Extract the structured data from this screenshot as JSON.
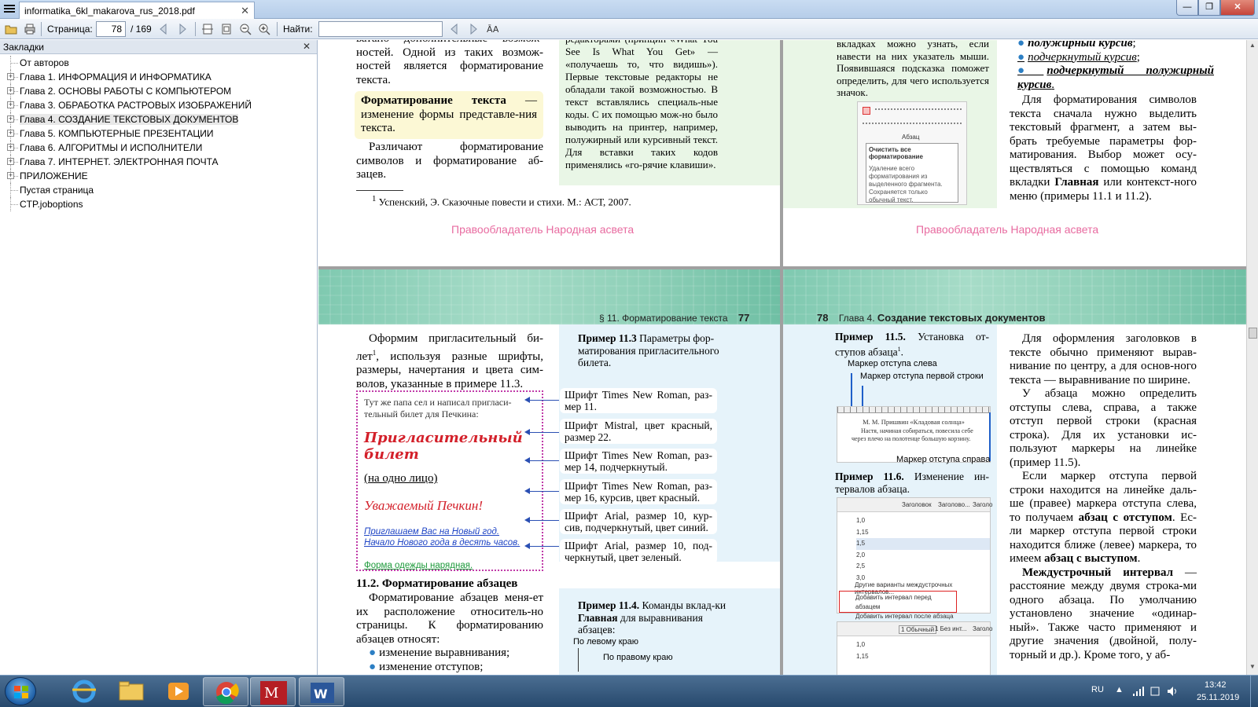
{
  "window": {
    "tab_title": "informatika_6kl_makarova_rus_2018.pdf",
    "tab_close": "✕",
    "min": "—",
    "max": "❐",
    "close": "✕"
  },
  "toolbar": {
    "page_label": "Страница:",
    "page_current": "78",
    "page_total": "/ 169",
    "find_label": "Найти:",
    "find_value": ""
  },
  "bookmarks": {
    "title": "Закладки",
    "close": "✕",
    "items": [
      {
        "label": "От авторов",
        "expandable": false
      },
      {
        "label": "Глава 1. ИНФОРМАЦИЯ И ИНФОРМАТИКА",
        "expandable": true
      },
      {
        "label": "Глава 2. ОСНОВЫ РАБОТЫ С КОМПЬЮТЕРОМ",
        "expandable": true
      },
      {
        "label": "Глава 3. ОБРАБОТКА РАСТРОВЫХ ИЗОБРАЖЕНИЙ",
        "expandable": true
      },
      {
        "label": "Глава 4. СОЗДАНИЕ ТЕКСТОВЫХ ДОКУМЕНТОВ",
        "expandable": true,
        "selected": true
      },
      {
        "label": "Глава 5. КОМПЬЮТЕРНЫЕ ПРЕЗЕНТАЦИИ",
        "expandable": true
      },
      {
        "label": "Глава 6. АЛГОРИТМЫ И ИСПОЛНИТЕЛИ",
        "expandable": true
      },
      {
        "label": "Глава 7. ИНТЕРНЕТ. ЭЛЕКТРОННАЯ ПОЧТА",
        "expandable": true
      },
      {
        "label": "ПРИЛОЖЕНИЕ",
        "expandable": true
      },
      {
        "label": "Пустая страница",
        "expandable": false
      },
      {
        "label": "CTP.joboptions",
        "expandable": false
      }
    ]
  },
  "page76": {
    "lead": "ватано дополнительные возмож-ностей. Одной из таких возмож-ностей является форматирование текста.",
    "def_term": "Форматирование текста",
    "def_rest": " — изменение формы представле-ния текста.",
    "distinguish": "Различают форматирование символов и форматирование аб-зацев.",
    "footnote": "Успенский, Э. Сказочные повести и стихи. М.: АСТ, 2007.",
    "footnote_mark": "1",
    "side_text": "редакторами (принцип «What You See Is What You Get» — «получаешь то, что видишь»). Первые текстовые редакторы не обладали такой возможностью. В текст вставлялись специаль-ные коды. С их помощью мож-но было выводить на принтер, например, полужирный или курсивный текст. Для вставки таких кодов применялись «го-рячие клавиши».",
    "watermark": "Правообладатель Народная асвета"
  },
  "page77": {
    "side_text": "вкладках можно узнать, если навести на них указатель мыши. Появившаяся подсказка поможет определить, для чего используется значок.",
    "tooltip_title": "Очистить все форматирование",
    "tooltip_body": "Удаление всего форматирования из выделенного фрагмента. Сохраняется только обычный текст.",
    "ribbon_group": "Абзац",
    "bullets": [
      "полужирный курсив",
      "подчеркнутый курсив",
      "подчеркнутый полужирный курсив"
    ],
    "bullet_suffix": [
      ";",
      ";",
      "."
    ],
    "body": "Для форматирования символов текста сначала нужно выделить текстовый фрагмент, а затем вы-брать требуемые параметры фор-матирования. Выбор может осу-ществляться с помощью команд вкладки ",
    "body_bold": "Главная",
    "body_end": " или контекст-ного меню (примеры 11.1 и 11.2).",
    "watermark": "Правообладатель Народная асвета"
  },
  "page_left": {
    "running_title": "§ 11. Форматирование текста",
    "page_number": "77",
    "intro_a": "Оформим пригласительный би-лет",
    "intro_sup": "1",
    "intro_b": ", используя разные шрифты, размеры, начертания и цвета сим-волов, указанные в примере 11.3.",
    "card": {
      "line1": "Тут же папа сел и написал пригласи-тельный билет для Печкина:",
      "line2": "Пригласительный билет",
      "line3": "(на одно лицо)",
      "line4": "Уважаемый Печкин!",
      "line5a": "Приглашаем Вас на Новый год.",
      "line5b": "Начало Нового года в десять часов.",
      "line6": "Форма одежды нарядная."
    },
    "example_head": "Пример 11.3",
    "example_text": " Параметры фор-матирования пригласительного билета.",
    "specs": [
      "Шрифт Times New Roman, раз-мер 11.",
      "Шрифт Mistral, цвет красный, размер 22.",
      "Шрифт Times New Roman, раз-мер 14, подчеркнутый.",
      "Шрифт Times New Roman, раз-мер 16, курсив, цвет красный.",
      "Шрифт Arial, размер 10, кур-сив, подчеркнутый, цвет синий.",
      "Шрифт Arial, размер 10, под-черкнутый, цвет зеленый."
    ],
    "section_title": "11.2. Форматирование абзацев",
    "section_body": "Форматирование абзацев меня-ет их расположение относитель-но страницы. К форматированию абзацев относят:",
    "list": [
      "изменение выравнивания;",
      "изменение отступов;"
    ],
    "example4_head": "Пример 11.4.",
    "example4_text": " Команды вклад-ки ",
    "example4_bold": "Главная",
    "example4_end": " для выравнивания абзацев:",
    "align_left": "По левому краю",
    "align_right": "По правому краю"
  },
  "page_right": {
    "page_number": "78",
    "running_chapter": "Глава 4.",
    "running_title": "Создание текстовых документов",
    "ex5_head": "Пример 11.5.",
    "ex5_text": " Установка от-ступов абзаца",
    "ex5_sup": "1",
    "ex5_end": ".",
    "marker_left": "Маркер отступа слева",
    "marker_first": "Маркер отступа первой строки",
    "marker_right": "Маркер отступа справа",
    "ruler_author": "М. М. Пришвин «Кладовая солнца»",
    "ruler_text": "Настя, начиная собираться, повесила себе через плечо на полотенце большую корзину.",
    "ex6_head": "Пример 11.6.",
    "ex6_text": " Изменение ин-тервалов абзаца.",
    "styles": [
      "Заголовок",
      "Заголово...",
      "Заголо"
    ],
    "spacing_values": [
      "1,0",
      "1,15",
      "1,5",
      "2,0",
      "2,5",
      "3,0"
    ],
    "spacing_other": "Другие варианты междустрочных интервалов...",
    "add_before": "Добавить интервал перед абзацем",
    "add_after": "Добавить интервал после абзаца",
    "styles2": [
      "1 Обычный",
      "1 Без инт...",
      "Заголо"
    ],
    "spacing2": [
      "1,0",
      "1,15"
    ],
    "p1": "Для оформления заголовков в тексте обычно применяют вырав-нивание по центру, а для основ-ного текста — выравнивание по ширине.",
    "p2": "У абзаца можно определить отступы слева, справа, а также отступ первой строки (красная строка). Для их установки ис-пользуют маркеры на линейке (пример 11.5).",
    "p3a": "Если маркер отступа первой строки находится на линейке даль-ше (правее) маркера отступа слева, то получаем ",
    "p3b": "абзац с отступом",
    "p3c": ". Ес-ли маркер отступа первой строки находится ближе (левее) маркера, то имеем ",
    "p3d": "абзац с выступом",
    "p3e": ".",
    "p4a": "Междустрочный интервал",
    "p4b": " — расстояние между двумя строка-ми одного абзаца. По умолчанию установлено значение «одинар-ный». Также часто применяют и другие значения (двойной, полу-торный и др.). Кроме того, у аб-"
  },
  "taskbar": {
    "lang": "RU",
    "time": "13:42",
    "date": "25.11.2019",
    "apps": [
      "internet-explorer",
      "file-explorer",
      "media-player",
      "chrome",
      "pdf-master",
      "word"
    ]
  },
  "colors": {
    "accent_red": "#d3202a",
    "link_blue": "#1f45c5",
    "green_text": "#1c9a3a",
    "watermark_pink": "#e86ba0",
    "banner_green": "#8fd0b8"
  }
}
